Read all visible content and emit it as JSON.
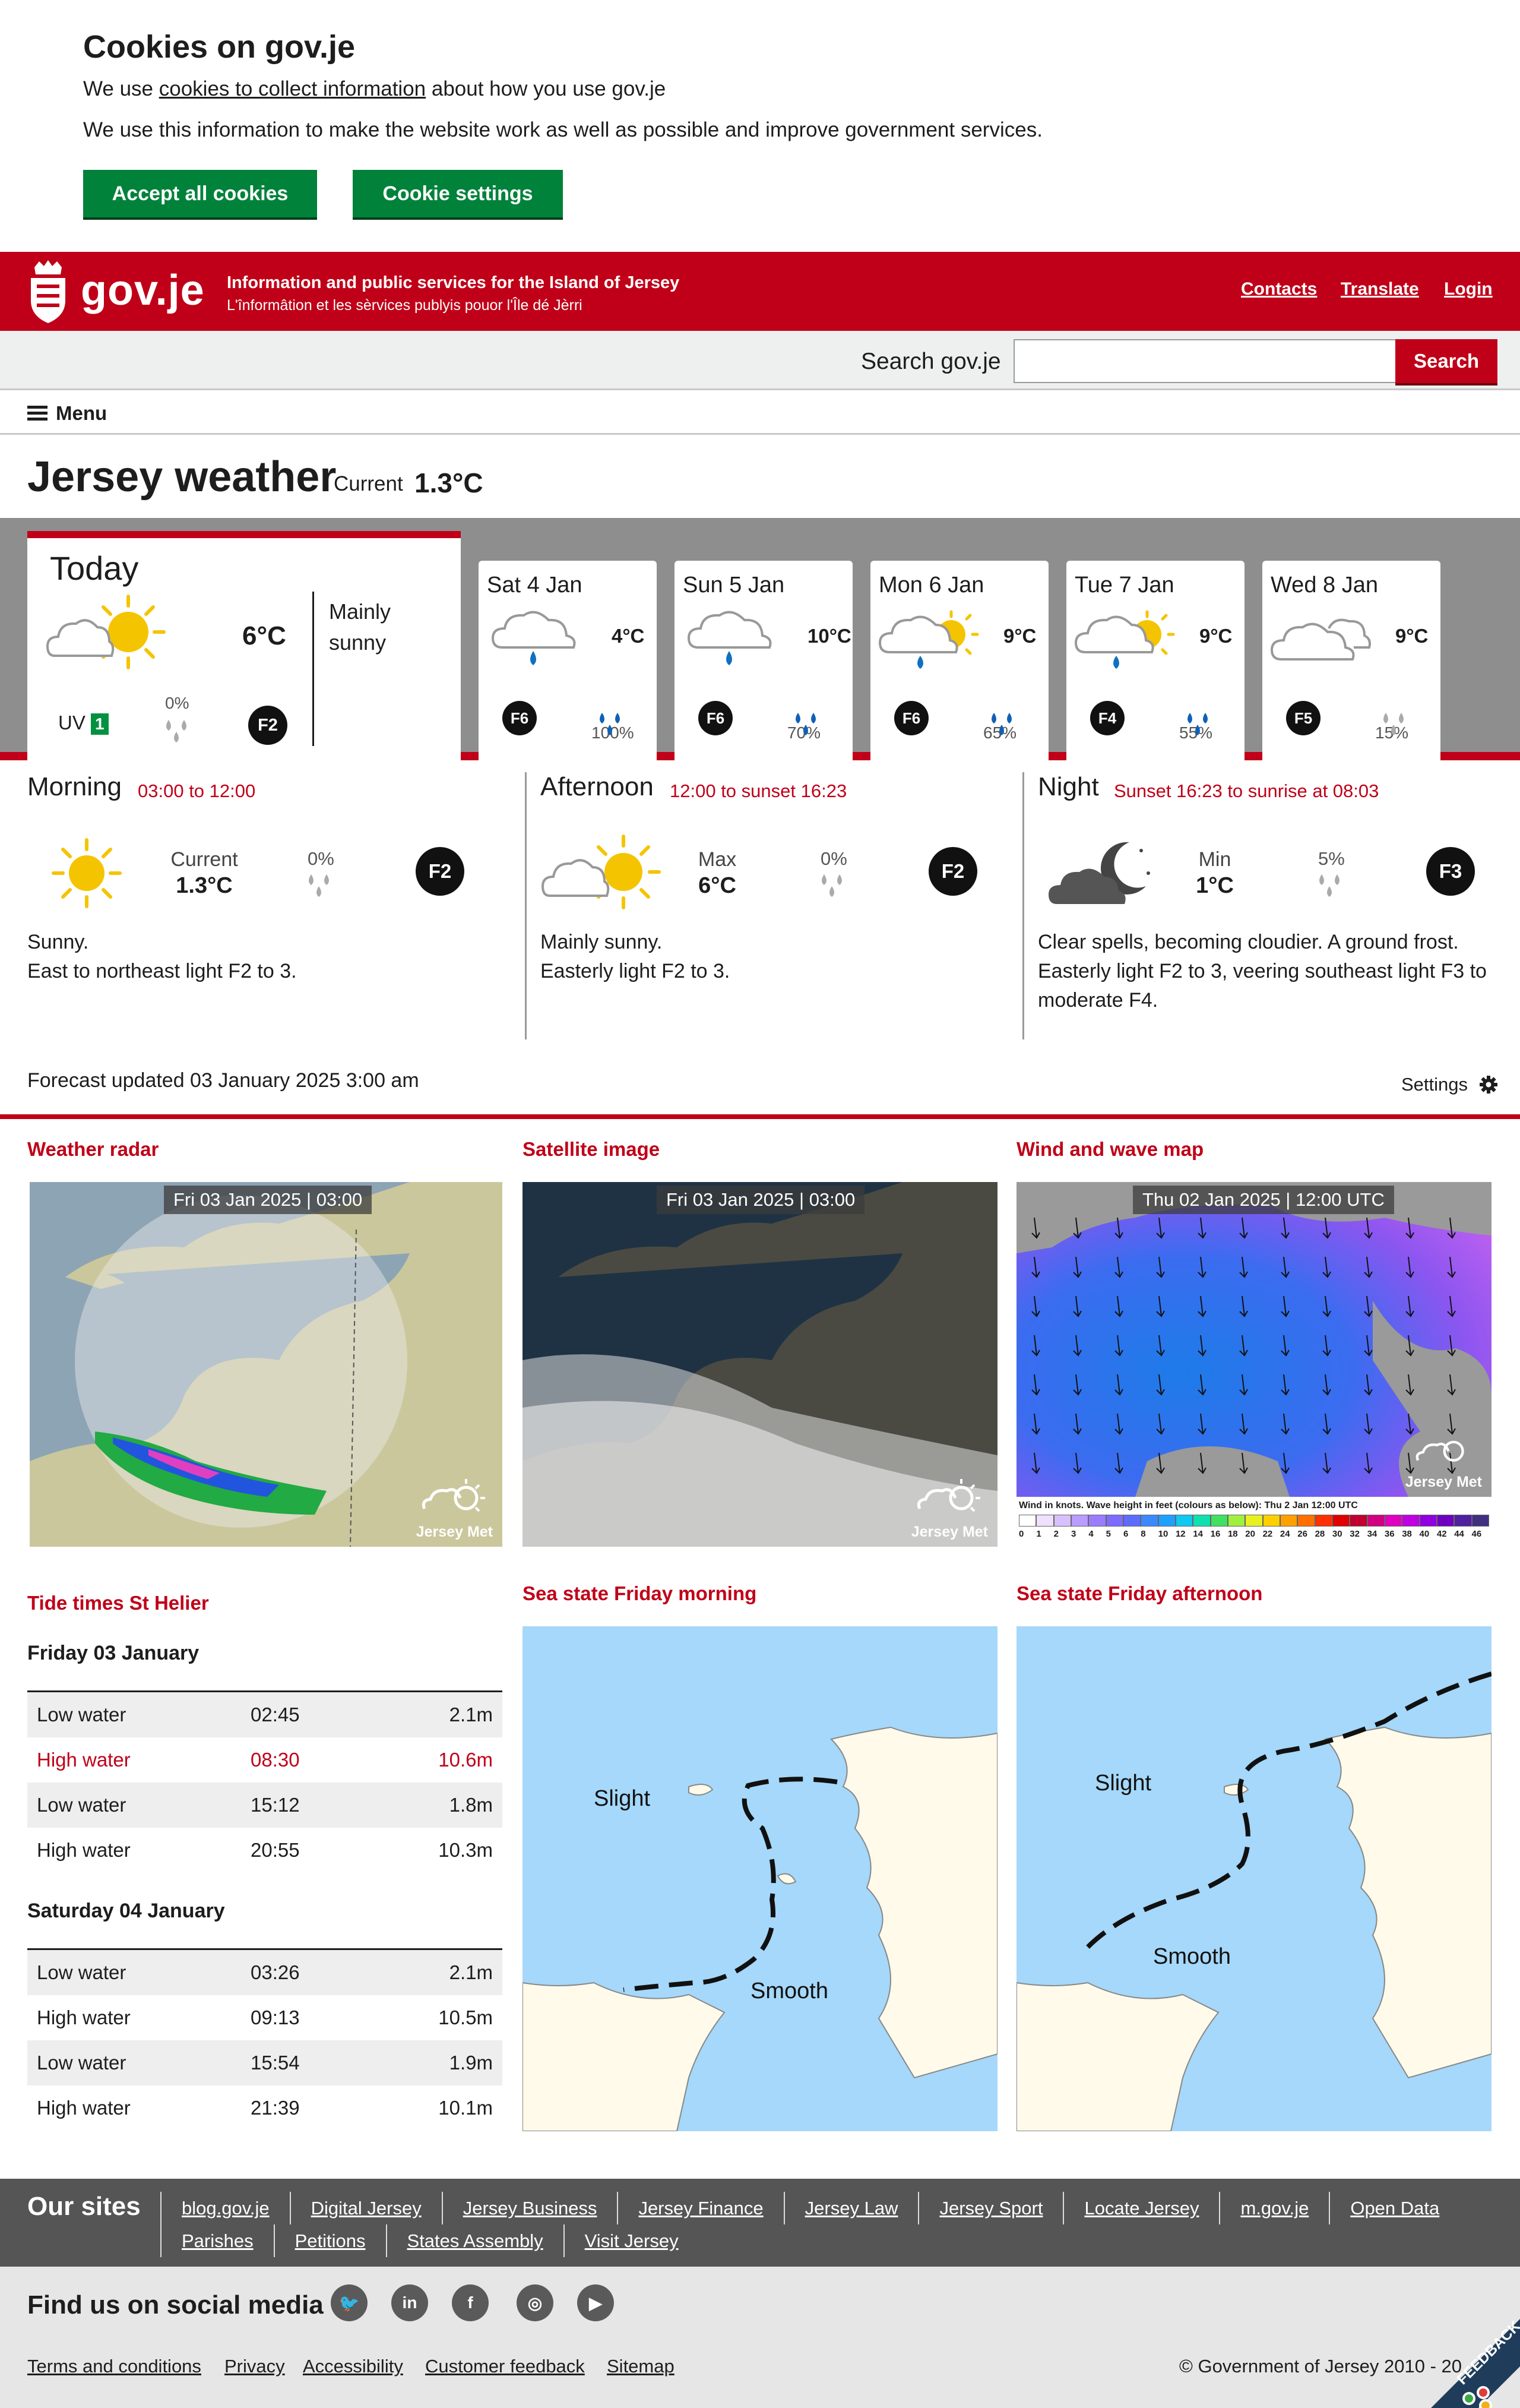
{
  "cookie": {
    "title": "Cookies on gov.je",
    "p1_pre": "We use ",
    "p1_link": "cookies to collect information",
    "p1_post": " about how you use gov.je",
    "p2": "We use this information to make the website work as well as possible and improve government services.",
    "accept": "Accept all cookies",
    "settings": "Cookie settings"
  },
  "header": {
    "logo": "gov.je",
    "tagline_en": "Information and public services for the Island of Jersey",
    "tagline_je": "L'înformâtion et les sèrvices publyis pouor l'Île dé Jèrri",
    "links": [
      "Contacts",
      "Translate",
      "Login"
    ]
  },
  "search": {
    "label": "Search gov.je",
    "placeholder": "",
    "button": "Search"
  },
  "menu": {
    "label": "Menu"
  },
  "page": {
    "title": "Jersey weather",
    "current_label": "Current",
    "current_value": "1.3°C"
  },
  "today": {
    "label": "Today",
    "temp": "6°C",
    "desc": "Mainly sunny",
    "uv_label": "UV",
    "uv_value": "1",
    "rain": "0%",
    "wind": "F2"
  },
  "days": [
    {
      "name": "Sat 4 Jan",
      "temp": "4°C",
      "rain": "100%",
      "wind": "F6",
      "icon": "cloud-rain-icon"
    },
    {
      "name": "Sun 5 Jan",
      "temp": "10°C",
      "rain": "70%",
      "wind": "F6",
      "icon": "cloud-rain-icon"
    },
    {
      "name": "Mon 6 Jan",
      "temp": "9°C",
      "rain": "65%",
      "wind": "F6",
      "icon": "sun-cloud-rain-icon"
    },
    {
      "name": "Tue 7 Jan",
      "temp": "9°C",
      "rain": "55%",
      "wind": "F4",
      "icon": "sun-cloud-rain-icon"
    },
    {
      "name": "Wed 8 Jan",
      "temp": "9°C",
      "rain": "15%",
      "wind": "F5",
      "icon": "cloud-icon"
    }
  ],
  "periods": [
    {
      "name": "Morning",
      "time": "03:00 to 12:00",
      "metric_label": "Current",
      "metric_value": "1.3°C",
      "rain": "0%",
      "wind": "F2",
      "text1": "Sunny.",
      "text2": "East to northeast light F2 to 3."
    },
    {
      "name": "Afternoon",
      "time": "12:00 to sunset 16:23",
      "metric_label": "Max",
      "metric_value": "6°C",
      "rain": "0%",
      "wind": "F2",
      "text1": "Mainly sunny.",
      "text2": "Easterly light F2 to 3."
    },
    {
      "name": "Night",
      "time": "Sunset 16:23 to sunrise at 08:03",
      "metric_label": "Min",
      "metric_value": "1°C",
      "rain": "5%",
      "wind": "F3",
      "text1": "Clear spells, becoming cloudier. A ground frost.",
      "text2": "Easterly light F2 to 3, veering southeast light F3 to moderate F4."
    }
  ],
  "updated": "Forecast updated 03 January 2025 3:00 am",
  "settings_label": "Settings",
  "maps": {
    "radar": {
      "title": "Weather radar",
      "timestamp": "Fri 03 Jan 2025 | 03:00"
    },
    "satellite": {
      "title": "Satellite image",
      "timestamp": "Fri 03 Jan 2025 | 03:00"
    },
    "wind": {
      "title": "Wind and wave map",
      "timestamp": "Thu 02 Jan 2025 | 12:00 UTC",
      "legend_title": "Wind in knots. Wave height in feet (colours as below): Thu 2 Jan 12:00 UTC",
      "legend_values": [
        "0",
        "1",
        "2",
        "3",
        "4",
        "5",
        "6",
        "8",
        "10",
        "12",
        "14",
        "16",
        "18",
        "20",
        "22",
        "24",
        "26",
        "28",
        "30",
        "32",
        "34",
        "36",
        "38",
        "40",
        "42",
        "44",
        "46"
      ]
    },
    "watermark": "Jersey Met"
  },
  "tides": {
    "title": "Tide times St Helier",
    "days": [
      {
        "label": "Friday 03 January",
        "rows": [
          {
            "type": "Low water",
            "time": "02:45",
            "height": "2.1m"
          },
          {
            "type": "High water",
            "time": "08:30",
            "height": "10.6m"
          },
          {
            "type": "Low water",
            "time": "15:12",
            "height": "1.8m"
          },
          {
            "type": "High water",
            "time": "20:55",
            "height": "10.3m"
          }
        ]
      },
      {
        "label": "Saturday 04 January",
        "rows": [
          {
            "type": "Low water",
            "time": "03:26",
            "height": "2.1m"
          },
          {
            "type": "High water",
            "time": "09:13",
            "height": "10.5m"
          },
          {
            "type": "Low water",
            "time": "15:54",
            "height": "1.9m"
          },
          {
            "type": "High water",
            "time": "21:39",
            "height": "10.1m"
          }
        ]
      }
    ]
  },
  "sea_state": {
    "morning": {
      "title": "Sea state Friday morning",
      "label_a": "Slight",
      "label_b": "Smooth"
    },
    "afternoon": {
      "title": "Sea state Friday afternoon",
      "label_a": "Slight",
      "label_b": "Smooth"
    }
  },
  "footer": {
    "sites_title": "Our sites",
    "sites": [
      "blog.gov.je",
      "Digital Jersey",
      "Jersey Business",
      "Jersey Finance",
      "Jersey Law",
      "Jersey Sport",
      "Locate Jersey",
      "m.gov.je",
      "Open Data",
      "Parishes",
      "Petitions",
      "States Assembly",
      "Visit Jersey"
    ],
    "social_title": "Find us on social media",
    "links": [
      "Terms and conditions",
      "Privacy",
      "Accessibility",
      "Customer feedback",
      "Sitemap"
    ],
    "copyright": "© Government of Jersey 2010 - 20",
    "feedback": "FEEDBACK"
  },
  "colors": {
    "brand_red": "#c00018",
    "accept_green": "#00823b",
    "footer_dark": "#555555"
  }
}
